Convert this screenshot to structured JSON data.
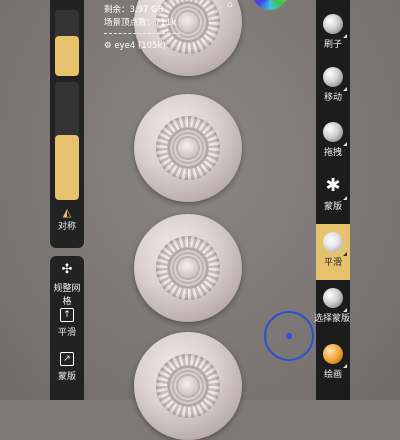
{
  "info": {
    "remaining": "剩余：3.97 GB",
    "vertices": "场景顶点数：711k",
    "mesh_name": "eye4 (105k)"
  },
  "left_panel": {
    "symmetry_label": "对称",
    "slider_top_fill": 0.6,
    "slider_bottom_fill": 0.55
  },
  "left_tools": [
    {
      "label": "规整网格",
      "icon": "topology-icon"
    },
    {
      "label": "平滑",
      "icon": "smooth-box-icon"
    },
    {
      "label": "蒙版",
      "icon": "mask-box-icon"
    }
  ],
  "right_tools": [
    {
      "label": "刷子",
      "icon": "brush-ball-icon"
    },
    {
      "label": "移动",
      "icon": "move-ball-icon"
    },
    {
      "label": "拖拽",
      "icon": "drag-ball-icon"
    },
    {
      "label": "蒙版",
      "icon": "mask-splat-icon"
    },
    {
      "label": "平滑",
      "icon": "smooth-ball-icon",
      "active": true
    },
    {
      "label": "选择蒙版",
      "icon": "select-mask-ball-icon"
    },
    {
      "label": "绘画",
      "icon": "paint-ball-icon"
    }
  ],
  "colors": {
    "accent": "#e7c26c",
    "panel": "#222222",
    "cursor": "#2b4fd8"
  }
}
